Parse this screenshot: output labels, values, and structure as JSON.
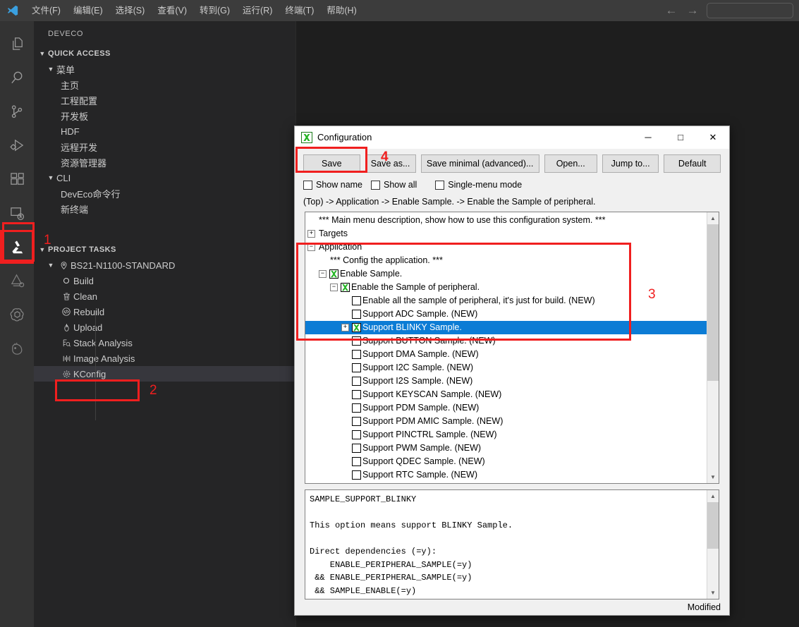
{
  "titlebar": {
    "logo_icon": "vscode-logo-icon",
    "menus": [
      {
        "label": "文件(F)"
      },
      {
        "label": "编辑(E)"
      },
      {
        "label": "选择(S)"
      },
      {
        "label": "查看(V)"
      },
      {
        "label": "转到(G)"
      },
      {
        "label": "运行(R)"
      },
      {
        "label": "终端(T)"
      },
      {
        "label": "帮助(H)"
      }
    ],
    "back_icon": "arrow-left-icon",
    "forward_icon": "arrow-right-icon",
    "command_center_placeholder": ""
  },
  "activitybar": {
    "items": [
      {
        "icon": "explorer-files-icon",
        "active": false
      },
      {
        "icon": "search-icon",
        "active": false
      },
      {
        "icon": "source-control-branch-icon",
        "active": false
      },
      {
        "icon": "run-and-debug-icon",
        "active": false
      },
      {
        "icon": "extensions-blocks-icon",
        "active": false
      },
      {
        "icon": "remote-explorer-icon",
        "active": false
      },
      {
        "icon": "deveco-device-tool-icon",
        "active": true
      },
      {
        "icon": "deveco-secondary-icon",
        "active": false
      },
      {
        "icon": "openai-chat-icon",
        "active": false
      },
      {
        "icon": "bird-assistant-icon",
        "active": false
      }
    ]
  },
  "sidebar": {
    "title": "DEVECO",
    "quick_access": {
      "header": "QUICK ACCESS",
      "groups": [
        {
          "label": "菜单",
          "expanded": true,
          "items": [
            {
              "label": "主页"
            },
            {
              "label": "工程配置"
            },
            {
              "label": "开发板"
            },
            {
              "label": "HDF"
            },
            {
              "label": "远程开发"
            },
            {
              "label": "资源管理器"
            }
          ]
        },
        {
          "label": "CLI",
          "expanded": true,
          "items": [
            {
              "label": "DevEco命令行"
            },
            {
              "label": "新终端"
            }
          ]
        }
      ]
    },
    "project_tasks": {
      "header": "PROJECT TASKS",
      "target": {
        "label": "BS21-N1100-STANDARD",
        "icon": "location-pin-icon"
      },
      "tasks": [
        {
          "label": "Build",
          "icon": "circle-icon",
          "selected": false
        },
        {
          "label": "Clean",
          "icon": "trash-icon",
          "selected": false
        },
        {
          "label": "Rebuild",
          "icon": "code-brackets-icon",
          "selected": false
        },
        {
          "label": "Upload",
          "icon": "flame-icon",
          "selected": false
        },
        {
          "label": "Stack Analysis",
          "icon": "stack-search-icon",
          "selected": false
        },
        {
          "label": "Image Analysis",
          "icon": "bar-chart-icon",
          "selected": false
        },
        {
          "label": "KConfig",
          "icon": "gear-icon",
          "selected": true
        }
      ]
    }
  },
  "dialog": {
    "title": "Configuration",
    "app_icon": "green-x-icon",
    "window_controls": {
      "minimize": "─",
      "maximize": "□",
      "close": "✕"
    },
    "toolbar": {
      "save": "Save",
      "save_as": "Save as...",
      "save_minimal": "Save minimal (advanced)...",
      "open": "Open...",
      "jump_to": "Jump to...",
      "default": "Default"
    },
    "checkboxes": [
      {
        "label": "Show name",
        "checked": false
      },
      {
        "label": "Show all",
        "checked": false
      },
      {
        "label": "Single-menu mode",
        "checked": false
      }
    ],
    "breadcrumb": "(Top) -> Application -> Enable Sample. -> Enable the Sample of peripheral.",
    "tree": [
      {
        "level": 0,
        "expander": "none",
        "checkbox": "none",
        "text": "*** Main menu description, show how to use this configuration system. ***",
        "selected": false
      },
      {
        "level": 0,
        "expander": "plus",
        "checkbox": "none",
        "text": "Targets",
        "selected": false
      },
      {
        "level": 0,
        "expander": "minus",
        "checkbox": "none",
        "text": "Application",
        "selected": false
      },
      {
        "level": 1,
        "expander": "none",
        "checkbox": "none",
        "text": "*** Config the application. ***",
        "selected": false
      },
      {
        "level": 1,
        "expander": "minus",
        "checkbox": "checked",
        "text": "Enable Sample.",
        "selected": false
      },
      {
        "level": 2,
        "expander": "minus",
        "checkbox": "checked",
        "text": "Enable the Sample of peripheral.",
        "selected": false
      },
      {
        "level": 3,
        "expander": "none",
        "checkbox": "unchecked",
        "text": "Enable all the sample of peripheral, it's just for build. (NEW)",
        "selected": false
      },
      {
        "level": 3,
        "expander": "none",
        "checkbox": "unchecked",
        "text": "Support ADC Sample. (NEW)",
        "selected": false
      },
      {
        "level": 3,
        "expander": "plus",
        "checkbox": "checked",
        "text": "Support BLINKY Sample.",
        "selected": true
      },
      {
        "level": 3,
        "expander": "none",
        "checkbox": "unchecked",
        "text": "Support BUTTON Sample. (NEW)",
        "selected": false
      },
      {
        "level": 3,
        "expander": "none",
        "checkbox": "unchecked",
        "text": "Support DMA Sample. (NEW)",
        "selected": false
      },
      {
        "level": 3,
        "expander": "none",
        "checkbox": "unchecked",
        "text": "Support I2C Sample. (NEW)",
        "selected": false
      },
      {
        "level": 3,
        "expander": "none",
        "checkbox": "unchecked",
        "text": "Support I2S Sample. (NEW)",
        "selected": false
      },
      {
        "level": 3,
        "expander": "none",
        "checkbox": "unchecked",
        "text": "Support KEYSCAN Sample. (NEW)",
        "selected": false
      },
      {
        "level": 3,
        "expander": "none",
        "checkbox": "unchecked",
        "text": "Support PDM Sample. (NEW)",
        "selected": false
      },
      {
        "level": 3,
        "expander": "none",
        "checkbox": "unchecked",
        "text": "Support PDM AMIC Sample. (NEW)",
        "selected": false
      },
      {
        "level": 3,
        "expander": "none",
        "checkbox": "unchecked",
        "text": "Support PINCTRL Sample. (NEW)",
        "selected": false
      },
      {
        "level": 3,
        "expander": "none",
        "checkbox": "unchecked",
        "text": "Support PWM Sample. (NEW)",
        "selected": false
      },
      {
        "level": 3,
        "expander": "none",
        "checkbox": "unchecked",
        "text": "Support QDEC Sample. (NEW)",
        "selected": false
      },
      {
        "level": 3,
        "expander": "none",
        "checkbox": "unchecked",
        "text": "Support RTC Sample. (NEW)",
        "selected": false
      }
    ],
    "help": "SAMPLE_SUPPORT_BLINKY\n\nThis option means support BLINKY Sample.\n\nDirect dependencies (=y):\n    ENABLE_PERIPHERAL_SAMPLE(=y)\n && ENABLE_PERIPHERAL_SAMPLE(=y)\n && SAMPLE_ENABLE(=y)\n\nDefault:\n  - n",
    "status": "Modified",
    "scroll_up_icon": "chevron-up-icon",
    "scroll_down_icon": "chevron-down-icon"
  },
  "annotations": {
    "accent_color": "#f01f1f",
    "markers": [
      {
        "number": "1",
        "target": "activity-bar-deveco-icon"
      },
      {
        "number": "2",
        "target": "sidebar-kconfig-task"
      },
      {
        "number": "3",
        "target": "configuration-tree-application-section"
      },
      {
        "number": "4",
        "target": "dialog-save-button"
      }
    ]
  }
}
